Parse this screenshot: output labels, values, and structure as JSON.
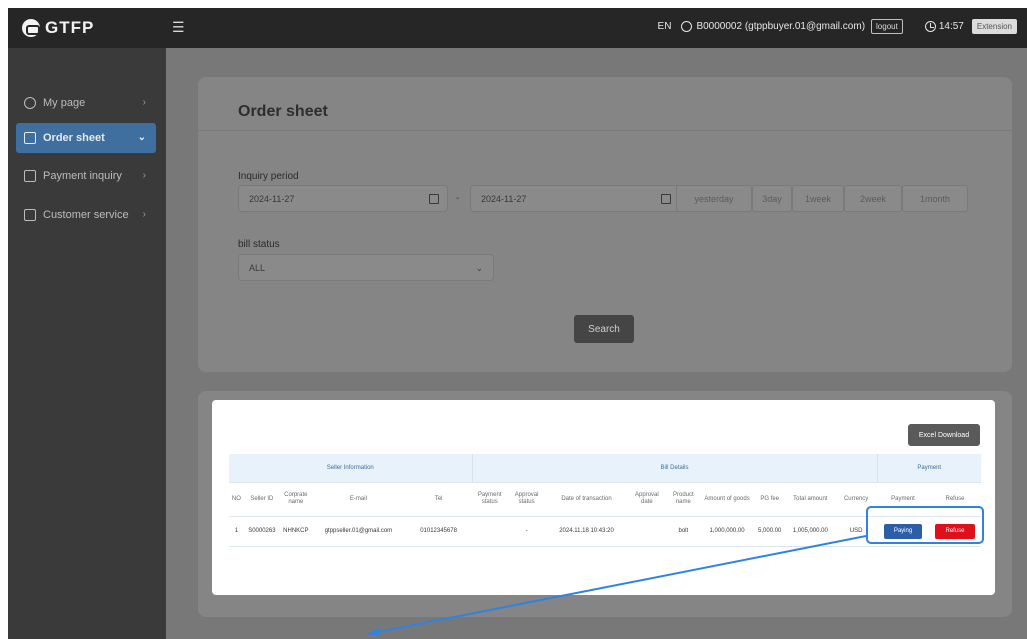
{
  "topbar": {
    "logo": "GTFP",
    "menu_toggle_icon": "☰",
    "lang": "EN",
    "user": "B0000002 (gtppbuyer.01@gmail.com)",
    "logout": "logout",
    "time": "14:57",
    "extension": "Extension"
  },
  "sidebar": {
    "items": [
      {
        "label": "My page",
        "icon": "user-icon",
        "active": false
      },
      {
        "label": "Order sheet",
        "icon": "document-icon",
        "active": true
      },
      {
        "label": "Payment inquiry",
        "icon": "clipboard-icon",
        "active": false
      },
      {
        "label": "Customer service",
        "icon": "headset-icon",
        "active": false
      }
    ]
  },
  "order": {
    "title": "Order sheet",
    "inquiry_label": "Inquiry period",
    "date_from": "2024-11-27",
    "date_to": "2024-11-27",
    "periods": [
      "yesterday",
      "3day",
      "1week",
      "2week",
      "1month"
    ],
    "bill_status_label": "bill status",
    "bill_status_value": "ALL",
    "search": "Search"
  },
  "modal": {
    "excel": "Excel Download",
    "groups": {
      "seller": "Seller Information",
      "bill": "Bill Details",
      "payment": "Payment"
    },
    "columns": [
      "NO",
      "Seller ID",
      "Corprate name",
      "E-mail",
      "Tel",
      "Payment status",
      "Approval status",
      "Date of transaction",
      "Approval date",
      "Product name",
      "Amount of goods",
      "PG fee",
      "Total amount",
      "Currency",
      "Payment",
      "Refuse"
    ],
    "row": {
      "no": "1",
      "seller_id": "S0000263",
      "corp": "NHNKCP",
      "email": "gtppseller.01@gmail.com",
      "tel": "01012345678",
      "payment_status": "",
      "approval_status": "-",
      "date": "2024.11.18 10:43:20",
      "approval_date": "",
      "product": "bolt",
      "amount": "1,000,000.00",
      "pg_fee": "5,000.00",
      "total": "1,005,000.00",
      "currency": "USD",
      "paying": "Paying",
      "refuse": "Refuse"
    }
  },
  "colors": {
    "accent": "#3f6f9e",
    "paying": "#2c5ea8",
    "refuse": "#e0101a",
    "annotation": "#2f83e0"
  }
}
